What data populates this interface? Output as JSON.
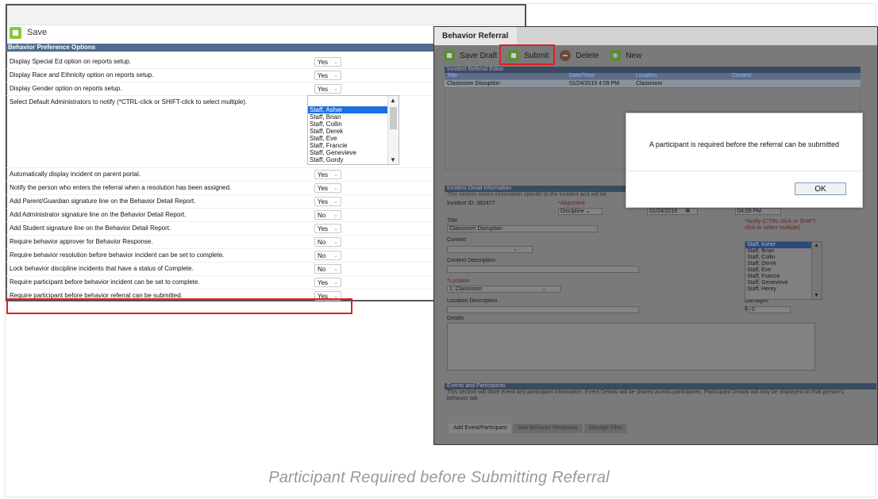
{
  "left_panel": {
    "save_label": "Save",
    "header": "Behavior Preference Options",
    "rows": [
      {
        "label": "Display Special Ed option on reports setup.",
        "value": "Yes"
      },
      {
        "label": "Display Race and Ethnicity option on reports setup.",
        "value": "Yes"
      },
      {
        "label": "Display Gender option on reports setup.",
        "value": "Yes"
      },
      {
        "label": "Select Default Administrators to notify (*CTRL-click or SHIFT-click to select multiple).",
        "value": ""
      },
      {
        "label": "Automatically display incident on parent portal.",
        "value": "Yes"
      },
      {
        "label": "Notify the person who enters the referral when a resolution has been assigned.",
        "value": "Yes"
      },
      {
        "label": "Add Parent/Guardian signature line on the Behavior Detail Report.",
        "value": "Yes"
      },
      {
        "label": "Add Administrator signature line on the Behavior Detail Report.",
        "value": "No"
      },
      {
        "label": "Add Student signature line on the Behavior Detail Report.",
        "value": "Yes"
      },
      {
        "label": "Require behavior approver for Behavior Response.",
        "value": "No"
      },
      {
        "label": "Require behavior resolution before behavior incident can be set to complete.",
        "value": "No"
      },
      {
        "label": "Lock behavior discipline incidents that have a status of Complete.",
        "value": "No"
      },
      {
        "label": "Require participant before behavior incident can be set to complete.",
        "value": "Yes"
      },
      {
        "label": "Require participant before behavior referral can be submitted.",
        "value": "Yes"
      }
    ],
    "admins": [
      "Staff, Asher",
      "Staff, Brian",
      "Staff, Collin",
      "Staff, Derek",
      "Staff, Eve",
      "Staff, Francie",
      "Staff, Genevieve",
      "Staff, Gordy"
    ]
  },
  "right_panel": {
    "title": "Behavior Referral",
    "toolbar": {
      "save_draft": "Save Draft",
      "submit": "Submit",
      "delete": "Delete",
      "new": "New"
    },
    "editor_header": "Incident Referral Editor",
    "columns": [
      "Title",
      "Date/Time",
      "Location",
      "Context"
    ],
    "row": [
      "Classroom Disruption",
      "01/24/2019 4:09 PM",
      "Classroom",
      ""
    ],
    "detail_header": "Incident Detail Information",
    "detail_desc": "This section stores information specific to the incident and will be",
    "incident_id": "Incident ID: 382477",
    "alignment_label": "*Alignment",
    "alignment_value": "Discipline",
    "date_value": "01/24/2019",
    "time_value": "04:09 PM",
    "title_label": "Title",
    "title_value": "Classroom Disruption",
    "context_label": "Context",
    "context_desc_label": "Context Description",
    "location_label": "*Location",
    "location_value": "1: Classroom",
    "location_desc_label": "Location Description",
    "notify_label": "*Notify (CTRL-click or SHIFT-click to select multiple)",
    "staff": [
      "Staff, Asher",
      "Staff, Brian",
      "Staff, Collin",
      "Staff, Derek",
      "Staff, Eve",
      "Staff, Francie",
      "Staff, Genevieve",
      "Staff, Henry"
    ],
    "damages_label": "Damages",
    "damages_currency": "$",
    "damages_value": "0",
    "details_label": "Details",
    "events_header": "Events and Participants",
    "events_desc": "This section will store event and participant information. Event Details will be shared across participants. Participant Details will only be displayed on that person's behavior tab.",
    "tabs": [
      "Add Event/Participant",
      "Add Behavior Response",
      "Manage Files"
    ]
  },
  "dialog": {
    "message": "A participant is required before the referral can be submitted",
    "ok_label": "OK"
  },
  "caption": "Participant Required before Submitting Referral"
}
